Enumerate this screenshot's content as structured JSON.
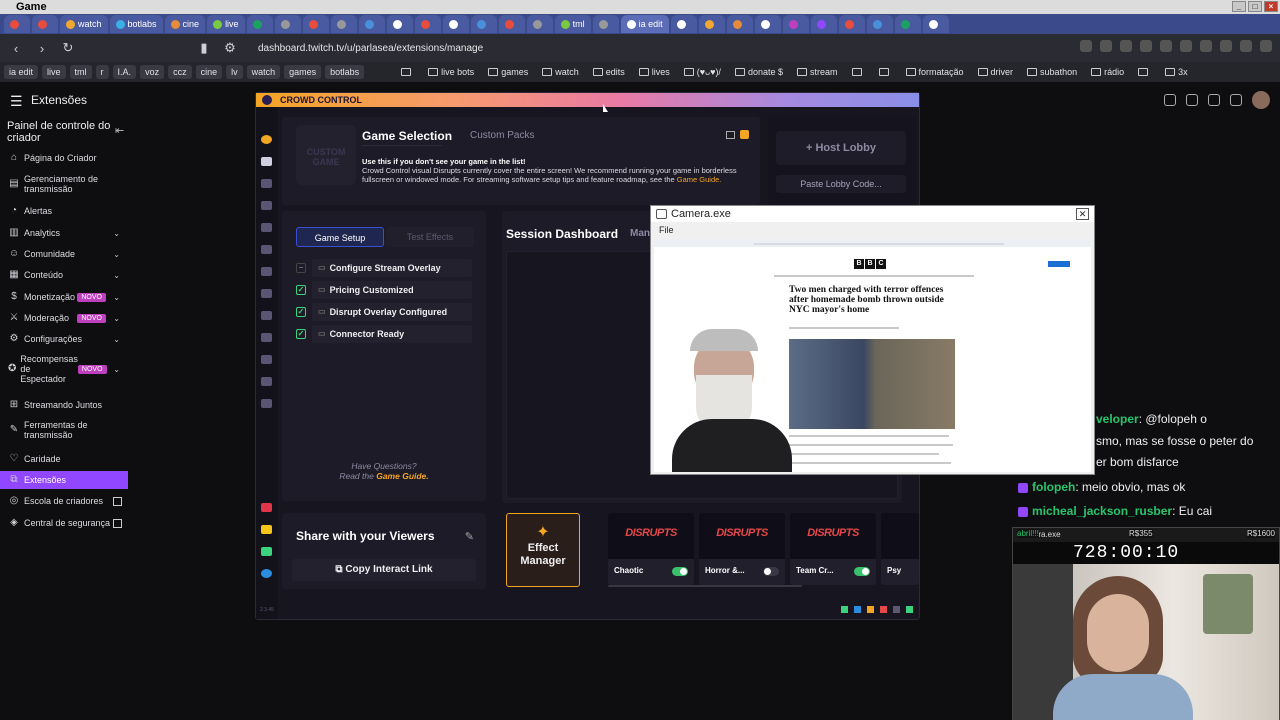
{
  "os": {
    "title": "Game",
    "controls": [
      "_",
      "□",
      "×"
    ]
  },
  "tabs": [
    {
      "label": "",
      "color": "#e74c3c"
    },
    {
      "label": "",
      "color": "#e74c3c"
    },
    {
      "label": "watch",
      "color": "#f0a830"
    },
    {
      "label": "botlabs",
      "color": "#3ab0e6"
    },
    {
      "label": "cine",
      "color": "#e58b3a"
    },
    {
      "label": "live",
      "color": "#7ac943"
    },
    {
      "label": "",
      "color": "#1aa260"
    },
    {
      "label": "",
      "color": "#999999"
    },
    {
      "label": "",
      "color": "#e74c3c"
    },
    {
      "label": "",
      "color": "#999999"
    },
    {
      "label": "",
      "color": "#4a90d9"
    },
    {
      "label": "",
      "color": "#ffffff"
    },
    {
      "label": "",
      "color": "#e74c3c"
    },
    {
      "label": "",
      "color": "#ffffff"
    },
    {
      "label": "",
      "color": "#4a90d9"
    },
    {
      "label": "",
      "color": "#e74c3c"
    },
    {
      "label": "",
      "color": "#999999"
    },
    {
      "label": "tml",
      "color": "#7ac943"
    },
    {
      "label": "",
      "color": "#999999"
    },
    {
      "label": "ia edit",
      "color": "#ffffff"
    },
    {
      "label": "",
      "color": "#ffffff"
    },
    {
      "label": "",
      "color": "#f0a830"
    },
    {
      "label": "",
      "color": "#e58b3a"
    },
    {
      "label": "",
      "color": "#ffffff"
    },
    {
      "label": "",
      "color": "#bf40bf"
    },
    {
      "label": "",
      "color": "#9146ff"
    },
    {
      "label": "",
      "color": "#e74c3c"
    },
    {
      "label": "",
      "color": "#4a90d9"
    },
    {
      "label": "",
      "color": "#1aa260"
    },
    {
      "label": "",
      "color": "#ffffff"
    }
  ],
  "nav": {
    "url": "dashboard.twitch.tv/u/parlasea/extensions/manage"
  },
  "bookmarks": [
    "ia edit",
    "live",
    "tml",
    "r",
    "I.A.",
    "voz",
    "ccz",
    "cine",
    "lv",
    "watch",
    "games",
    "botlabs",
    "",
    "",
    "",
    "live bots",
    "games",
    "watch",
    "edits",
    "lives",
    "(♥ᴗ♥)/",
    "donate $",
    "stream",
    "",
    "",
    "formatação",
    "driver",
    "subathon",
    "rádio",
    "",
    "3x"
  ],
  "twitch": {
    "header_title": "Extensões",
    "sidebar_title": "Painel de controle do criador",
    "collapse": "⇤",
    "novo": "NOVO",
    "items": [
      {
        "label": "Página do Criador",
        "icon": "⌂",
        "chev": false,
        "novo": false,
        "ext": false,
        "active": false
      },
      {
        "label": "Gerenciamento de transmissão",
        "icon": "▤",
        "chev": false,
        "novo": false,
        "ext": false,
        "active": false
      },
      {
        "label": "Alertas",
        "icon": "◔",
        "chev": false,
        "novo": false,
        "ext": false,
        "active": false
      },
      {
        "label": "Analytics",
        "icon": "▥",
        "chev": true,
        "novo": false,
        "ext": false,
        "active": false
      },
      {
        "label": "Comunidade",
        "icon": "☺",
        "chev": true,
        "novo": false,
        "ext": false,
        "active": false
      },
      {
        "label": "Conteúdo",
        "icon": "▦",
        "chev": true,
        "novo": false,
        "ext": false,
        "active": false
      },
      {
        "label": "Monetização",
        "icon": "$",
        "chev": true,
        "novo": true,
        "ext": false,
        "active": false
      },
      {
        "label": "Moderação",
        "icon": "⚔",
        "chev": true,
        "novo": true,
        "ext": false,
        "active": false
      },
      {
        "label": "Configurações",
        "icon": "⚙",
        "chev": true,
        "novo": false,
        "ext": false,
        "active": false
      },
      {
        "label": "Recompensas de Espectador",
        "icon": "✪",
        "chev": true,
        "novo": true,
        "ext": false,
        "active": false
      },
      {
        "label": "Streamando Juntos",
        "icon": "⊞",
        "chev": false,
        "novo": false,
        "ext": false,
        "active": false
      },
      {
        "label": "Ferramentas de transmissão",
        "icon": "✎",
        "chev": false,
        "novo": false,
        "ext": false,
        "active": false
      },
      {
        "label": "Caridade",
        "icon": "♡",
        "chev": false,
        "novo": false,
        "ext": false,
        "active": false
      },
      {
        "label": "Extensões",
        "icon": "⧉",
        "chev": false,
        "novo": false,
        "ext": false,
        "active": true
      },
      {
        "label": "Escola de criadores",
        "icon": "◎",
        "chev": false,
        "novo": false,
        "ext": true,
        "active": false
      },
      {
        "label": "Central de segurança",
        "icon": "◈",
        "chev": false,
        "novo": false,
        "ext": true,
        "active": false
      }
    ]
  },
  "cc": {
    "window_title": "CROWD CONTROL",
    "game_selection": "Game Selection",
    "custom_packs": "Custom Packs",
    "custom_game": "CUSTOM GAME",
    "hint_title": "Use this if you don't see your game in the list!",
    "hint_body": "Crowd Control visual Disrupts currently cover the entire screen! We recommend running your game in borderless fullscreen or windowed mode. For streaming software setup tips and feature roadmap, see the",
    "hint_link": "Game Guide.",
    "host_lobby": "Host Lobby",
    "paste_lobby": "Paste Lobby Code...",
    "tab_setup": "Game Setup",
    "tab_test": "Test Effects",
    "checks": [
      {
        "label": "Configure Stream Overlay",
        "checked": false
      },
      {
        "label": "Pricing Customized",
        "checked": true
      },
      {
        "label": "Disrupt Overlay Configured",
        "checked": true
      },
      {
        "label": "Connector Ready",
        "checked": true
      }
    ],
    "session_dashboard": "Session Dashboard",
    "session_tab": "Man",
    "questions": "Have Questions?",
    "read_the": "Read the",
    "game_guide": "Game Guide.",
    "share_title": "Share with your Viewers",
    "copy_link": "Copy Interact Link",
    "effect_manager": "Effect Manager",
    "version": "2.3.45",
    "cards": [
      {
        "art": "DISRUPTS",
        "name": "Chaotic",
        "on": true
      },
      {
        "art": "DISRUPTS",
        "name": "Horror &...",
        "on": false
      },
      {
        "art": "DISRUPTS",
        "name": "Team Cr...",
        "on": true
      },
      {
        "art": "D",
        "name": "Psy",
        "on": false
      }
    ]
  },
  "camera": {
    "title": "Camera.exe",
    "menu": "File",
    "close": "✕",
    "bbc": [
      "B",
      "B",
      "C"
    ],
    "headline": "Two men charged with terror offences after homemade bomb thrown outside NYC mayor's home"
  },
  "chat": [
    {
      "user": "",
      "text_a": "veloper",
      "text_b": ": @folopeh o"
    },
    {
      "user": "",
      "text_a": "",
      "text_b": "smo, mas se fosse o peter do"
    },
    {
      "user": "",
      "text_a": "",
      "text_b": "er bom disfarce"
    },
    {
      "user": "folopeh",
      "text_a": "",
      "text_b": ": meio obvio, mas ok"
    },
    {
      "user": "micheal_jackson_rusber",
      "text_a": "",
      "text_b": ": Eu cai"
    }
  ],
  "webcam": {
    "title": "Camera.exe",
    "sub": "abril!!!",
    "val1": "R$355",
    "val2": "R$1600",
    "timer": "728:00:10"
  }
}
